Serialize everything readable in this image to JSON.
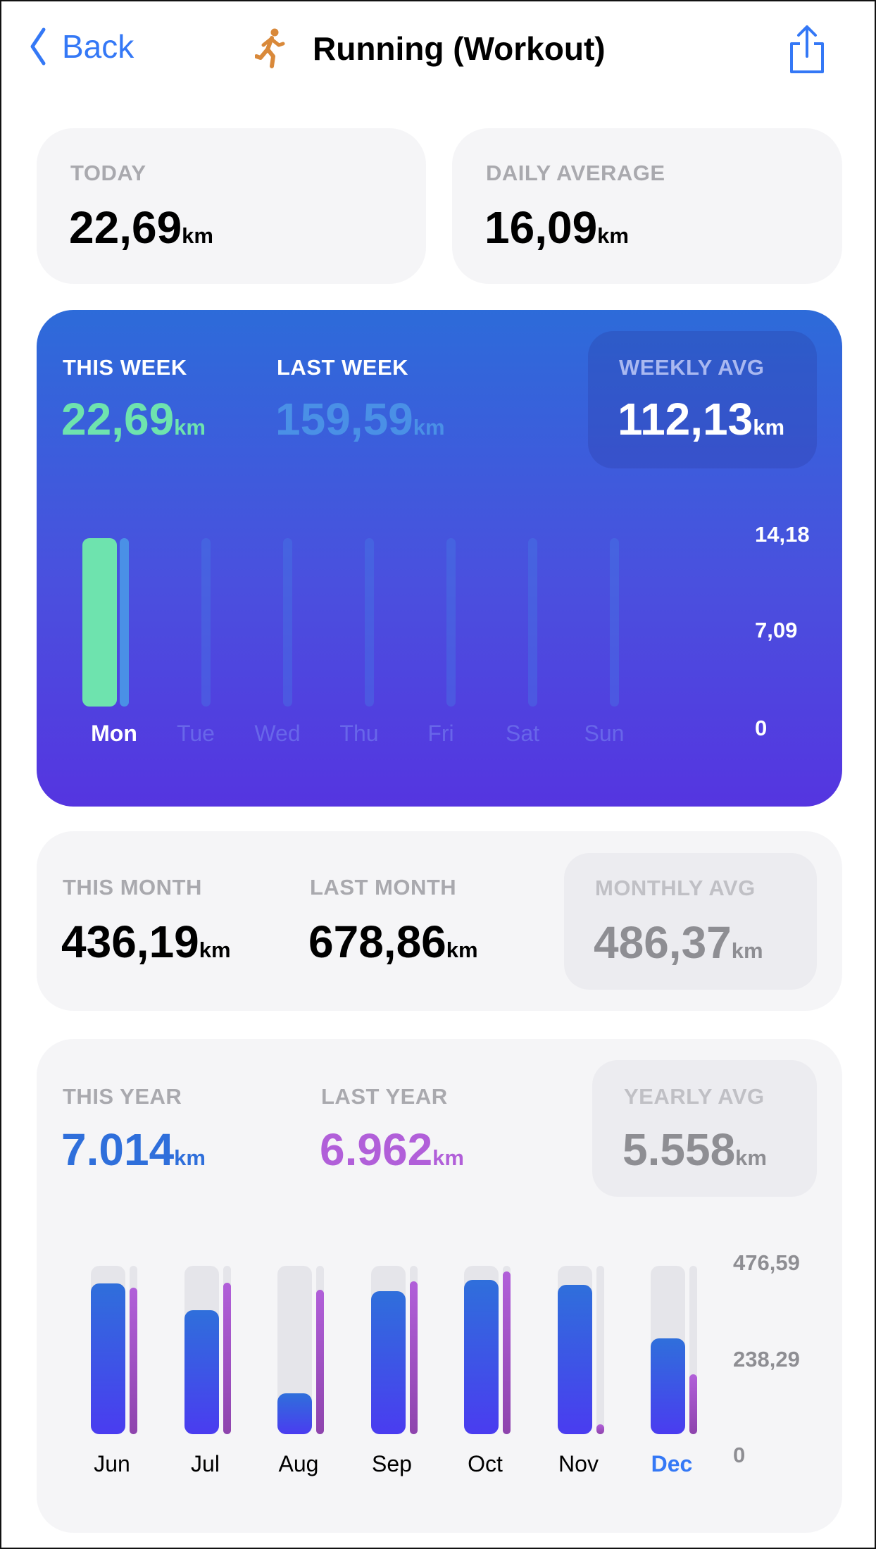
{
  "header": {
    "back_label": "Back",
    "title": "Running (Workout)",
    "icon": "running-figure-icon",
    "share_icon": "share-icon"
  },
  "today": {
    "label": "TODAY",
    "value": "22,69",
    "unit": "km"
  },
  "daily_average": {
    "label": "DAILY AVERAGE",
    "value": "16,09",
    "unit": "km"
  },
  "week": {
    "this_label": "THIS WEEK",
    "this_value": "22,69",
    "last_label": "LAST WEEK",
    "last_value": "159,59",
    "avg_label": "WEEKLY AVG",
    "avg_value": "112,13",
    "unit": "km"
  },
  "month": {
    "this_label": "THIS MONTH",
    "this_value": "436,19",
    "last_label": "LAST MONTH",
    "last_value": "678,86",
    "avg_label": "MONTHLY AVG",
    "avg_value": "486,37",
    "unit": "km"
  },
  "year": {
    "this_label": "THIS YEAR",
    "this_value": "7.014",
    "last_label": "LAST YEAR",
    "last_value": "6.962",
    "avg_label": "YEARLY AVG",
    "avg_value": "5.558",
    "unit": "km"
  },
  "colors": {
    "accent": "#3478f6",
    "this_week": "#6ee3ae",
    "last_week": "#4a90e6",
    "this_year": "#2f6fdb",
    "last_year": "#b15fd9"
  },
  "chart_data": [
    {
      "type": "bar",
      "categories": [
        "Mon",
        "Tue",
        "Wed",
        "Thu",
        "Fri",
        "Sat",
        "Sun"
      ],
      "highlight": "Mon",
      "series": [
        {
          "values": [
            22.69,
            0,
            0,
            0,
            0,
            0,
            0
          ]
        },
        {
          "values": [
            22.69,
            0,
            0,
            0,
            0,
            0,
            0
          ]
        }
      ],
      "yticks": [
        "14,18",
        "7,09",
        "0"
      ],
      "ylim": [
        0,
        22.69
      ]
    },
    {
      "type": "bar",
      "categories": [
        "Jun",
        "Jul",
        "Aug",
        "Sep",
        "Oct",
        "Nov",
        "Dec"
      ],
      "highlight": "Dec",
      "series": [
        {
          "values": [
            687,
            565,
            186,
            650,
            703,
            679,
            436
          ]
        },
        {
          "values": [
            666,
            690,
            658,
            698,
            742,
            46,
            272
          ]
        }
      ],
      "yticks": [
        "476,59",
        "238,29",
        "0"
      ],
      "ylim": [
        0,
        767
      ]
    }
  ]
}
